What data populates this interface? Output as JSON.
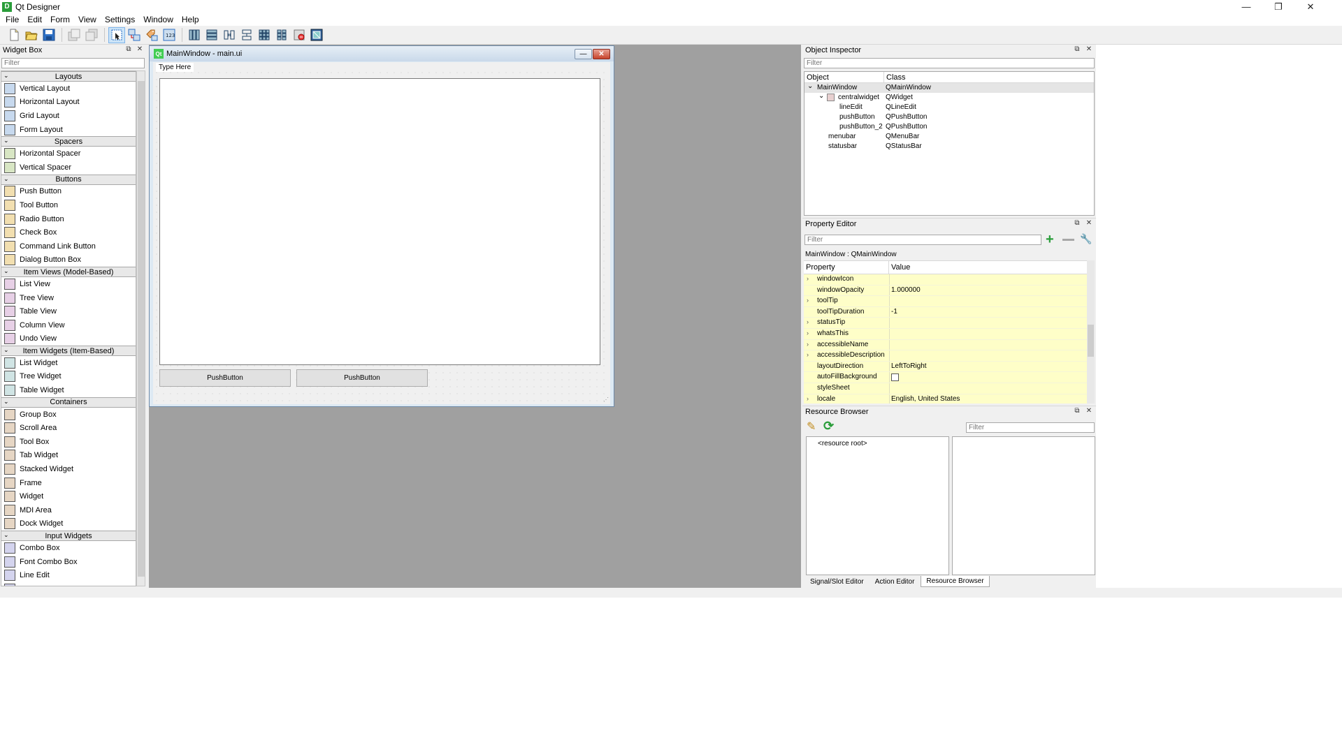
{
  "window": {
    "title": "Qt Designer",
    "icon_letter": "D",
    "controls": [
      "minimize-icon",
      "restore-icon",
      "close-icon"
    ],
    "control_glyphs": [
      "—",
      "❐",
      "✕"
    ]
  },
  "menubar": [
    "File",
    "Edit",
    "Form",
    "View",
    "Settings",
    "Window",
    "Help"
  ],
  "toolbar": {
    "buttons": [
      "new-file-icon",
      "open-file-icon",
      "save-icon",
      "bring-to-front-icon",
      "send-to-back-icon",
      "edit-widgets-icon",
      "edit-signals-slots-icon",
      "edit-buddies-icon",
      "edit-tab-order-icon",
      "layout-horizontal-icon",
      "layout-vertical-icon",
      "layout-horizontal-splitter-icon",
      "layout-vertical-splitter-icon",
      "layout-grid-icon",
      "layout-form-icon",
      "break-layout-icon",
      "adjust-size-icon"
    ]
  },
  "widget_box": {
    "title": "Widget Box",
    "filter_placeholder": "Filter",
    "categories": [
      {
        "name": "Layouts",
        "items": [
          "Vertical Layout",
          "Horizontal Layout",
          "Grid Layout",
          "Form Layout"
        ]
      },
      {
        "name": "Spacers",
        "items": [
          "Horizontal Spacer",
          "Vertical Spacer"
        ]
      },
      {
        "name": "Buttons",
        "items": [
          "Push Button",
          "Tool Button",
          "Radio Button",
          "Check Box",
          "Command Link Button",
          "Dialog Button Box"
        ]
      },
      {
        "name": "Item Views (Model-Based)",
        "items": [
          "List View",
          "Tree View",
          "Table View",
          "Column View",
          "Undo View"
        ]
      },
      {
        "name": "Item Widgets (Item-Based)",
        "items": [
          "List Widget",
          "Tree Widget",
          "Table Widget"
        ]
      },
      {
        "name": "Containers",
        "items": [
          "Group Box",
          "Scroll Area",
          "Tool Box",
          "Tab Widget",
          "Stacked Widget",
          "Frame",
          "Widget",
          "MDI Area",
          "Dock Widget"
        ]
      },
      {
        "name": "Input Widgets",
        "items": [
          "Combo Box",
          "Font Combo Box",
          "Line Edit",
          "Text Edit"
        ]
      }
    ]
  },
  "form": {
    "title": "MainWindow - main.ui",
    "menu_placeholder": "Type Here",
    "buttons": [
      "PushButton",
      "PushButton"
    ],
    "qt_logo_text": "Qt"
  },
  "object_inspector": {
    "title": "Object Inspector",
    "filter_placeholder": "Filter",
    "columns": [
      "Object",
      "Class"
    ],
    "rows": [
      {
        "object": "MainWindow",
        "class": "QMainWindow",
        "depth": 0,
        "expanded": true,
        "selected": true
      },
      {
        "object": "centralwidget",
        "class": "QWidget",
        "depth": 1,
        "expanded": true,
        "selected": false
      },
      {
        "object": "lineEdit",
        "class": "QLineEdit",
        "depth": 2,
        "expanded": false,
        "selected": false
      },
      {
        "object": "pushButton",
        "class": "QPushButton",
        "depth": 2,
        "expanded": false,
        "selected": false
      },
      {
        "object": "pushButton_2",
        "class": "QPushButton",
        "depth": 2,
        "expanded": false,
        "selected": false
      },
      {
        "object": "menubar",
        "class": "QMenuBar",
        "depth": 1,
        "expanded": false,
        "selected": false
      },
      {
        "object": "statusbar",
        "class": "QStatusBar",
        "depth": 1,
        "expanded": false,
        "selected": false
      }
    ]
  },
  "property_editor": {
    "title": "Property Editor",
    "filter_placeholder": "Filter",
    "object_class": "MainWindow : QMainWindow",
    "columns": [
      "Property",
      "Value"
    ],
    "rows": [
      {
        "name": "windowIcon",
        "value": "",
        "expandable": true
      },
      {
        "name": "windowOpacity",
        "value": "1.000000",
        "expandable": false
      },
      {
        "name": "toolTip",
        "value": "",
        "expandable": true
      },
      {
        "name": "toolTipDuration",
        "value": "-1",
        "expandable": false
      },
      {
        "name": "statusTip",
        "value": "",
        "expandable": true
      },
      {
        "name": "whatsThis",
        "value": "",
        "expandable": true
      },
      {
        "name": "accessibleName",
        "value": "",
        "expandable": true
      },
      {
        "name": "accessibleDescription",
        "value": "",
        "expandable": true
      },
      {
        "name": "layoutDirection",
        "value": "LeftToRight",
        "expandable": false
      },
      {
        "name": "autoFillBackground",
        "value": "checkbox-unchecked",
        "expandable": false
      },
      {
        "name": "styleSheet",
        "value": "",
        "expandable": false
      },
      {
        "name": "locale",
        "value": "English, United States",
        "expandable": true
      }
    ],
    "row_color": "#fefec8"
  },
  "resource_browser": {
    "title": "Resource Browser",
    "filter_placeholder": "Filter",
    "root_label": "<resource root>"
  },
  "bottom_tabs": [
    {
      "label": "Signal/Slot Editor",
      "active": false
    },
    {
      "label": "Action Editor",
      "active": false
    },
    {
      "label": "Resource Browser",
      "active": true
    }
  ],
  "colors": {
    "mdi_background": "#a0a0a0",
    "accent_green": "#2a9d3a"
  }
}
